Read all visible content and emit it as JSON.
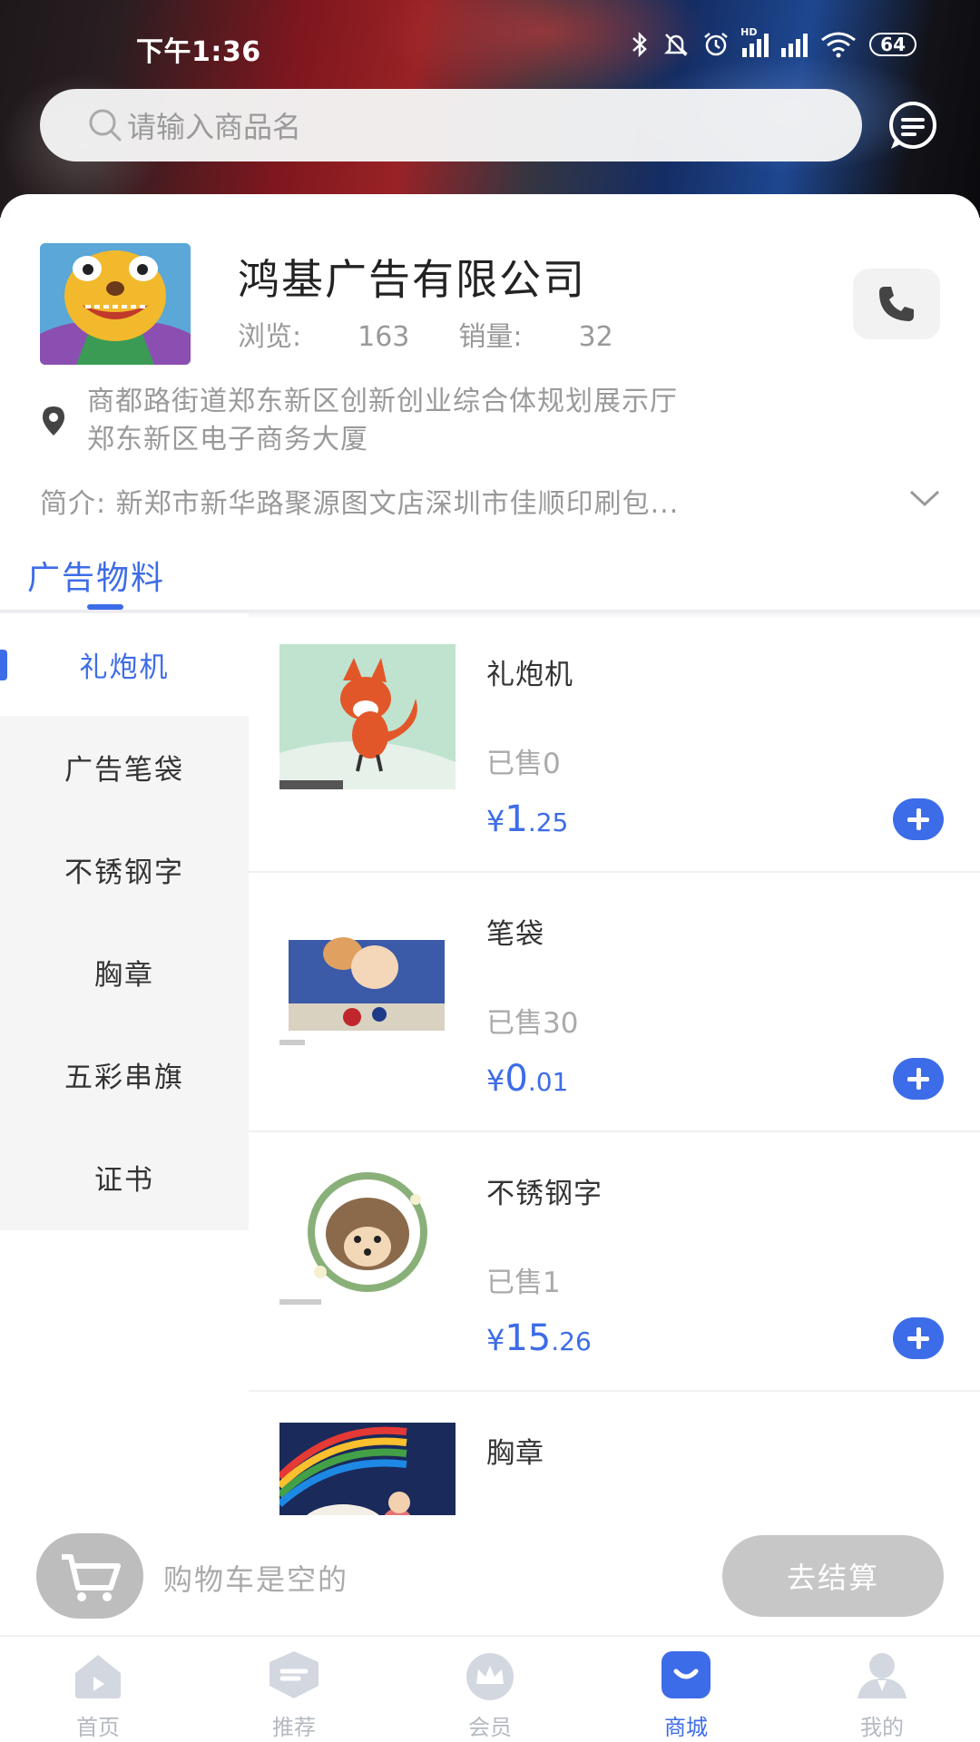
{
  "status_bar": {
    "time": "下午1:36",
    "hd": "HD",
    "battery": "64"
  },
  "search": {
    "placeholder": "请输入商品名"
  },
  "shop": {
    "name": "鸿基广告有限公司",
    "views_label": "浏览:",
    "views": "163",
    "sales_label": "销量:",
    "sales": "32",
    "address_line1": "商都路街道郑东新区创新创业综合体规划展示厅",
    "address_line2": "郑东新区电子商务大厦",
    "intro": "简介: 新郑市新华路聚源图文店深圳市佳顺印刷包..."
  },
  "category_tab": {
    "label": "广告物料"
  },
  "sidebar": {
    "items": [
      {
        "label": "礼炮机",
        "active": true
      },
      {
        "label": "广告笔袋"
      },
      {
        "label": "不锈钢字"
      },
      {
        "label": "胸章"
      },
      {
        "label": "五彩串旗"
      },
      {
        "label": "证书"
      }
    ]
  },
  "products": [
    {
      "name": "礼炮机",
      "sold": "已售0",
      "currency": "¥",
      "price_int": "1",
      "price_dec": ".25",
      "image": "fox-illustration"
    },
    {
      "name": "笔袋",
      "sold": "已售30",
      "currency": "¥",
      "price_int": "0",
      "price_dec": ".01",
      "image": "cat-illustration"
    },
    {
      "name": "不锈钢字",
      "sold": "已售1",
      "currency": "¥",
      "price_int": "15",
      "price_dec": ".26",
      "image": "hedgehog-illustration"
    },
    {
      "name": "胸章",
      "image": "rainbow-illustration"
    }
  ],
  "cart": {
    "empty_text": "购物车是空的",
    "checkout_label": "去结算"
  },
  "tabbar": {
    "items": [
      {
        "label": "首页",
        "icon": "home-icon"
      },
      {
        "label": "推荐",
        "icon": "recommend-icon"
      },
      {
        "label": "会员",
        "icon": "crown-icon"
      },
      {
        "label": "商城",
        "icon": "shop-bag-icon",
        "active": true
      },
      {
        "label": "我的",
        "icon": "profile-icon"
      }
    ]
  },
  "colors": {
    "accent": "#3d6ce8",
    "muted": "#999999",
    "sidebar_bg": "#f5f5f5"
  }
}
